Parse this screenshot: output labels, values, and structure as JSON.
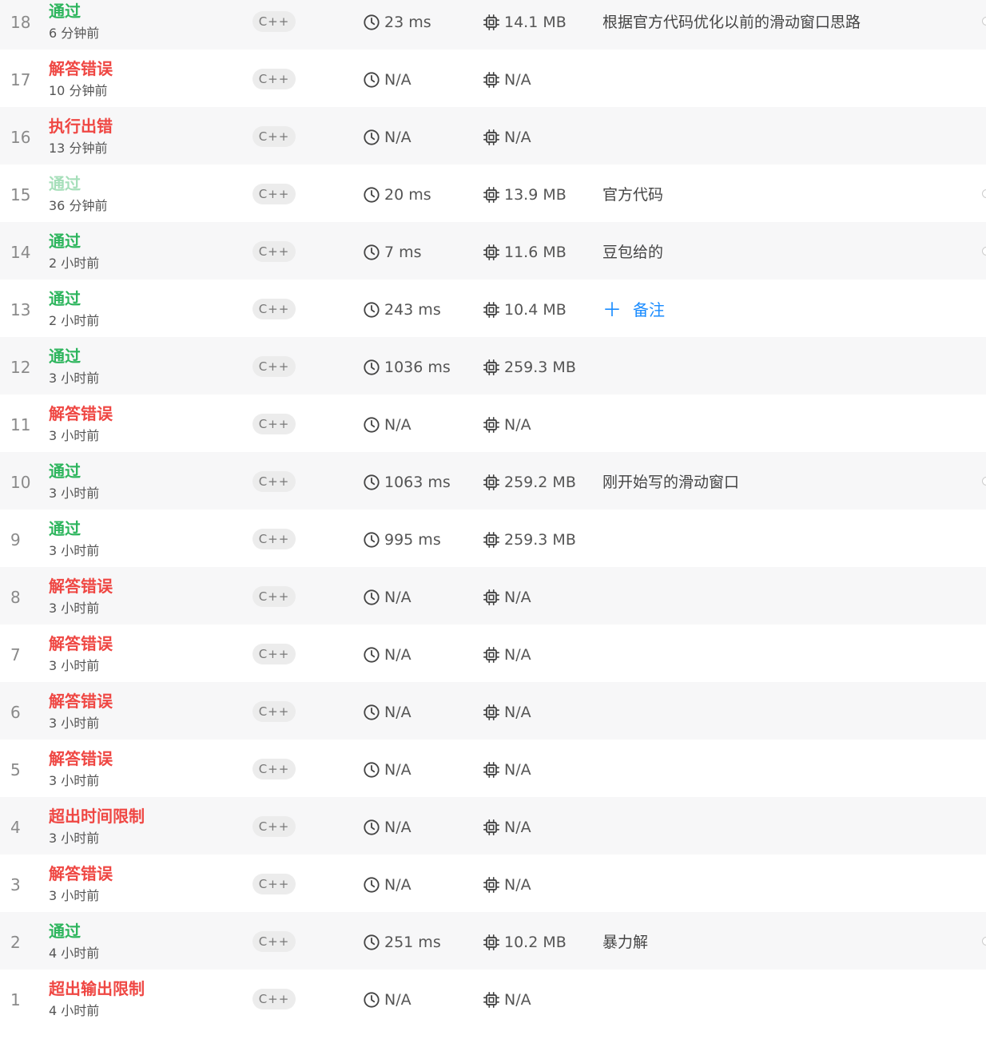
{
  "submissions": [
    {
      "index": "18",
      "status": "通过",
      "status_type": "ok",
      "time_ago": "6 分钟前",
      "language": "C++",
      "runtime": "23 ms",
      "memory": "14.1 MB",
      "note": "根据官方代码优化以前的滑动窗口思路",
      "edge_mark": true
    },
    {
      "index": "17",
      "status": "解答错误",
      "status_type": "err",
      "time_ago": "10 分钟前",
      "language": "C++",
      "runtime": "N/A",
      "memory": "N/A",
      "note": ""
    },
    {
      "index": "16",
      "status": "执行出错",
      "status_type": "err",
      "time_ago": "13 分钟前",
      "language": "C++",
      "runtime": "N/A",
      "memory": "N/A",
      "note": ""
    },
    {
      "index": "15",
      "status": "通过",
      "status_type": "faded",
      "time_ago": "36 分钟前",
      "language": "C++",
      "runtime": "20 ms",
      "memory": "13.9 MB",
      "note": "官方代码",
      "edge_mark": true
    },
    {
      "index": "14",
      "status": "通过",
      "status_type": "ok",
      "time_ago": "2 小时前",
      "language": "C++",
      "runtime": "7 ms",
      "memory": "11.6 MB",
      "note": "豆包给的",
      "edge_mark": true
    },
    {
      "index": "13",
      "status": "通过",
      "status_type": "ok",
      "time_ago": "2 小时前",
      "language": "C++",
      "runtime": "243 ms",
      "memory": "10.4 MB",
      "note": "",
      "add_note": "备注"
    },
    {
      "index": "12",
      "status": "通过",
      "status_type": "ok",
      "time_ago": "3 小时前",
      "language": "C++",
      "runtime": "1036 ms",
      "memory": "259.3 MB",
      "note": ""
    },
    {
      "index": "11",
      "status": "解答错误",
      "status_type": "err",
      "time_ago": "3 小时前",
      "language": "C++",
      "runtime": "N/A",
      "memory": "N/A",
      "note": ""
    },
    {
      "index": "10",
      "status": "通过",
      "status_type": "ok",
      "time_ago": "3 小时前",
      "language": "C++",
      "runtime": "1063 ms",
      "memory": "259.2 MB",
      "note": "刚开始写的滑动窗口",
      "edge_mark": true
    },
    {
      "index": "9",
      "status": "通过",
      "status_type": "ok",
      "time_ago": "3 小时前",
      "language": "C++",
      "runtime": "995 ms",
      "memory": "259.3 MB",
      "note": ""
    },
    {
      "index": "8",
      "status": "解答错误",
      "status_type": "err",
      "time_ago": "3 小时前",
      "language": "C++",
      "runtime": "N/A",
      "memory": "N/A",
      "note": ""
    },
    {
      "index": "7",
      "status": "解答错误",
      "status_type": "err",
      "time_ago": "3 小时前",
      "language": "C++",
      "runtime": "N/A",
      "memory": "N/A",
      "note": ""
    },
    {
      "index": "6",
      "status": "解答错误",
      "status_type": "err",
      "time_ago": "3 小时前",
      "language": "C++",
      "runtime": "N/A",
      "memory": "N/A",
      "note": ""
    },
    {
      "index": "5",
      "status": "解答错误",
      "status_type": "err",
      "time_ago": "3 小时前",
      "language": "C++",
      "runtime": "N/A",
      "memory": "N/A",
      "note": ""
    },
    {
      "index": "4",
      "status": "超出时间限制",
      "status_type": "err",
      "time_ago": "3 小时前",
      "language": "C++",
      "runtime": "N/A",
      "memory": "N/A",
      "note": ""
    },
    {
      "index": "3",
      "status": "解答错误",
      "status_type": "err",
      "time_ago": "3 小时前",
      "language": "C++",
      "runtime": "N/A",
      "memory": "N/A",
      "note": ""
    },
    {
      "index": "2",
      "status": "通过",
      "status_type": "ok",
      "time_ago": "4 小时前",
      "language": "C++",
      "runtime": "251 ms",
      "memory": "10.2 MB",
      "note": "暴力解",
      "edge_mark": true
    },
    {
      "index": "1",
      "status": "超出输出限制",
      "status_type": "err",
      "time_ago": "4 小时前",
      "language": "C++",
      "runtime": "N/A",
      "memory": "N/A",
      "note": ""
    }
  ],
  "colors": {
    "accepted": "#2db55d",
    "error": "#ef4743",
    "accepted_faded": "#a6dfba",
    "link": "#1a8cff",
    "row_shade": "#f7f7f8"
  },
  "icons": {
    "runtime": "clock-icon",
    "memory": "chip-icon",
    "add_note": "plus-icon"
  }
}
